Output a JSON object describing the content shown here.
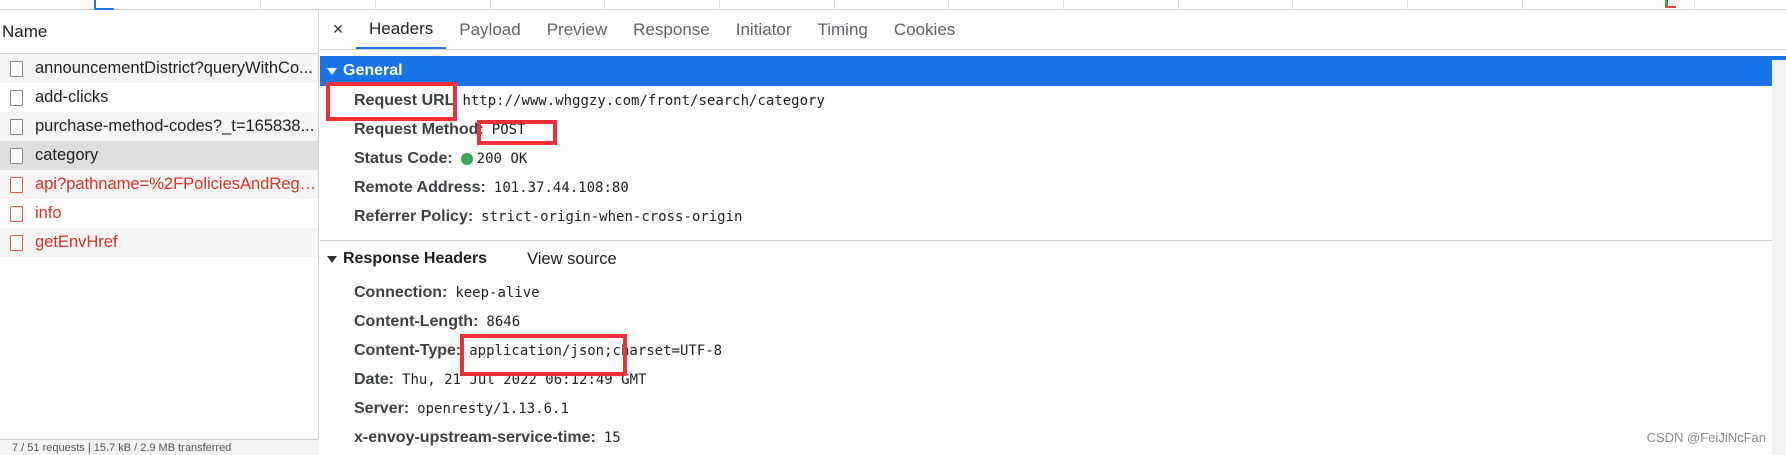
{
  "request_list": {
    "header": "Name",
    "items": [
      {
        "name": "announcementDistrict?queryWithCo...",
        "state": "alt"
      },
      {
        "name": "add-clicks",
        "state": "normal"
      },
      {
        "name": "purchase-method-codes?_t=165838...",
        "state": "alt"
      },
      {
        "name": "category",
        "state": "selected"
      },
      {
        "name": "api?pathname=%2FPoliciesAndRegu...",
        "state": "error-alt"
      },
      {
        "name": "info",
        "state": "error"
      },
      {
        "name": "getEnvHref",
        "state": "error-alt"
      }
    ],
    "footer": "7 / 51 requests | 15.7 kB / 2.9 MB transferred"
  },
  "tabs": {
    "close": "×",
    "items": [
      "Headers",
      "Payload",
      "Preview",
      "Response",
      "Initiator",
      "Timing",
      "Cookies"
    ],
    "active": "Headers"
  },
  "general": {
    "title": "General",
    "rows": [
      {
        "key": "Request URL",
        "value": "http://www.whggzy.com/front/search/category"
      },
      {
        "key": "Request Method:",
        "value": "POST"
      },
      {
        "key": "Status Code:",
        "value": "200 OK"
      },
      {
        "key": "Remote Address:",
        "value": "101.37.44.108:80"
      },
      {
        "key": "Referrer Policy:",
        "value": "strict-origin-when-cross-origin"
      }
    ]
  },
  "response_headers": {
    "title": "Response Headers",
    "view_source": "View source",
    "rows": [
      {
        "key": "Connection:",
        "value": "keep-alive"
      },
      {
        "key": "Content-Length:",
        "value": "8646"
      },
      {
        "key": "Content-Type:",
        "value": "application/json;charset=UTF-8"
      },
      {
        "key": "Date:",
        "value": "Thu, 21 Jul 2022 06:12:49 GMT"
      },
      {
        "key": "Server:",
        "value": "openresty/1.13.6.1"
      },
      {
        "key": "x-envoy-upstream-service-time:",
        "value": "15"
      }
    ]
  },
  "watermark": "CSDN @FeiJiNcFan",
  "colors": {
    "accent": "#1a73e8",
    "error": "#d93025",
    "highlight": "#ef3038",
    "status_ok": "#34a853"
  }
}
